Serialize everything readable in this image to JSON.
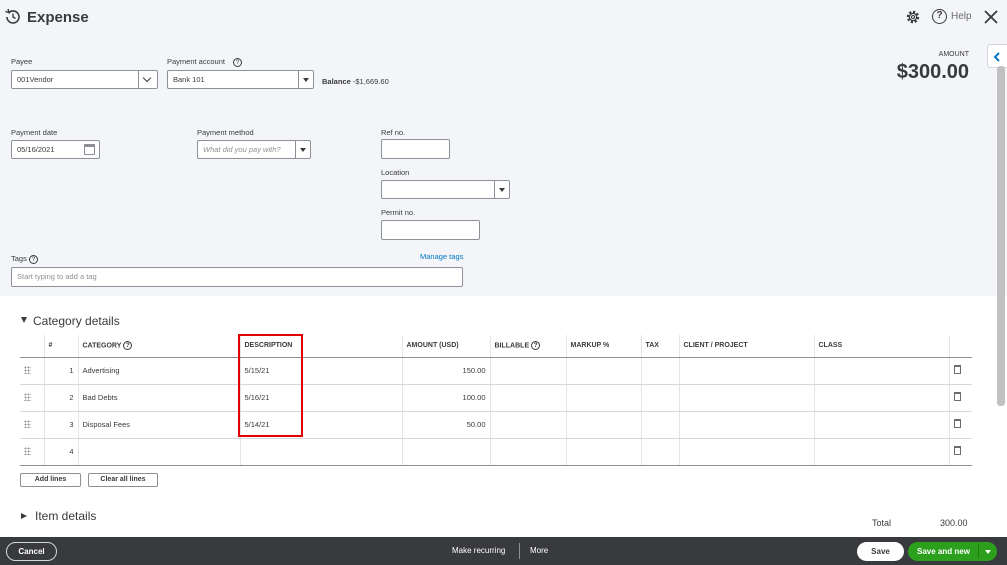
{
  "header": {
    "title": "Expense",
    "help_label": "Help"
  },
  "payee": {
    "label": "Payee",
    "value": "001Vendor"
  },
  "payment_account": {
    "label": "Payment account",
    "value": "Bank 101",
    "balance_label": "Balance",
    "balance_value": "-$1,669.60"
  },
  "amount": {
    "label": "AMOUNT",
    "value": "$300.00"
  },
  "payment_date": {
    "label": "Payment date",
    "value": "05/16/2021"
  },
  "payment_method": {
    "label": "Payment method",
    "placeholder": "What did you pay with?"
  },
  "ref_no": {
    "label": "Ref no.",
    "value": ""
  },
  "location": {
    "label": "Location",
    "value": ""
  },
  "permit_no": {
    "label": "Permit no.",
    "value": ""
  },
  "tags": {
    "label": "Tags",
    "placeholder": "Start typing to add a tag",
    "manage_link": "Manage tags"
  },
  "category_details": {
    "title": "Category details",
    "columns": {
      "num": "#",
      "category": "CATEGORY",
      "description": "DESCRIPTION",
      "amount": "AMOUNT (USD)",
      "billable": "BILLABLE",
      "markup": "MARKUP %",
      "tax": "TAX",
      "client": "CLIENT / PROJECT",
      "class": "CLASS"
    },
    "rows": [
      {
        "num": "1",
        "category": "Advertising",
        "description": "5/15/21",
        "amount": "150.00"
      },
      {
        "num": "2",
        "category": "Bad Debts",
        "description": "5/16/21",
        "amount": "100.00"
      },
      {
        "num": "3",
        "category": "Disposal Fees",
        "description": "5/14/21",
        "amount": "50.00"
      },
      {
        "num": "4",
        "category": "",
        "description": "",
        "amount": ""
      }
    ],
    "add_lines": "Add lines",
    "clear_lines": "Clear all lines"
  },
  "item_details": {
    "title": "Item details"
  },
  "total": {
    "label": "Total",
    "value": "300.00"
  },
  "footer": {
    "cancel": "Cancel",
    "make_recurring": "Make recurring",
    "more": "More",
    "save": "Save",
    "save_and_new": "Save and new"
  }
}
